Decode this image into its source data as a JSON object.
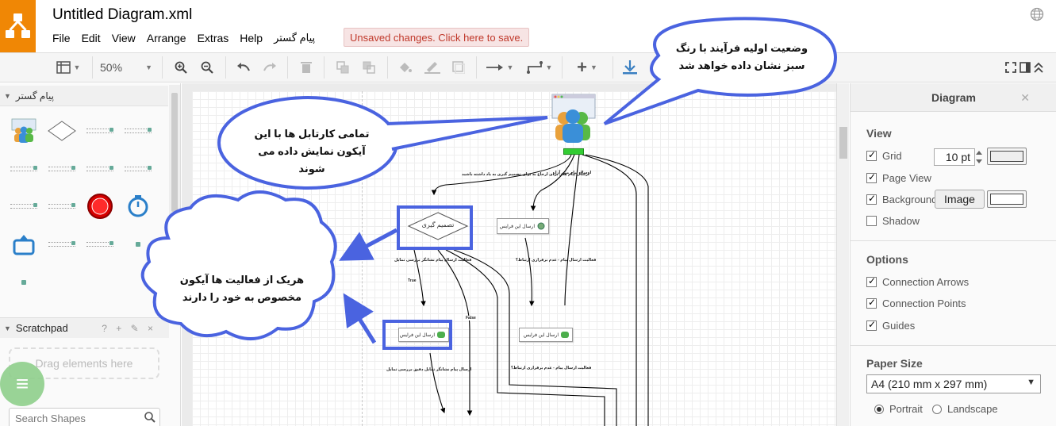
{
  "app": {
    "file_title": "Untitled Diagram.xml",
    "menu": [
      "File",
      "Edit",
      "View",
      "Arrange",
      "Extras",
      "Help",
      "پیام گستر"
    ],
    "unsaved_notice": "Unsaved changes. Click here to save."
  },
  "toolbar": {
    "zoom": "50%"
  },
  "sidebar": {
    "library_title": "پیام گستر",
    "scratchpad_title": "Scratchpad",
    "scratchpad_tools": "? + ✎ ×",
    "drop_hint": "Drag elements here",
    "search_placeholder": "Search Shapes"
  },
  "format_panel": {
    "title": "Diagram",
    "view_title": "View",
    "grid_label": "Grid",
    "grid_size": "10 pt",
    "page_view_label": "Page View",
    "background_label": "Background",
    "image_button": "Image",
    "shadow_label": "Shadow",
    "options_title": "Options",
    "connection_arrows_label": "Connection Arrows",
    "connection_points_label": "Connection Points",
    "guides_label": "Guides",
    "paper_size_title": "Paper Size",
    "paper_size_value": "A4 (210 mm x 297 mm)",
    "portrait_label": "Portrait",
    "landscape_label": "Landscape",
    "checked": {
      "grid": true,
      "page_view": true,
      "background": true,
      "shadow": false,
      "connection_arrows": true,
      "connection_points": true,
      "guides": true
    },
    "orientation": "portrait"
  },
  "diagram": {
    "decision_label": "تصمیم گیری",
    "true_label": "True",
    "false_label": "False",
    "action_label": "ارسال این فرایس",
    "edge_labels": [
      "ارسال پیام های برای ارجاع به برای تصمیم گیری به یاد داشته باشید",
      "ارسال پیام متن آزار",
      "فعالیت ارسال پیام نشانگر بررسی تمایل",
      "فعالیت ارسال پیام - عدم برقراری ارتباط؟",
      "ارسال پیام نشانگر تمایل دقیق بررسی تمایل",
      "فعالیت ارسال پیام - عدم برقراری ارتباط؟"
    ]
  },
  "callouts": {
    "top_right": "وضعیت اولیه فرآیند با رنگ سبز نشان داده خواهد شد",
    "top_left": "تمامی کارتابل ها با این آیکون نمایش داده می شوند",
    "cloud": "هریک از فعالیت ها آیکون مخصوص به خود را دارند"
  },
  "colors": {
    "brand_orange": "#f08705",
    "highlight_blue": "#4a63e0",
    "callout_fill": "#ffffff",
    "start_green": "#33cc33",
    "unsaved_red": "#c0392b"
  }
}
